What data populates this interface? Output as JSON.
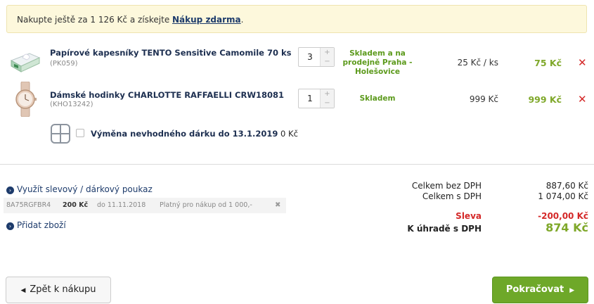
{
  "banner": {
    "text": "Nakupte ještě za 1 126 Kč a získejte ",
    "link": "Nákup zdarma",
    "suffix": "."
  },
  "items": [
    {
      "name": "Papírové kapesníky TENTO Sensitive Camomile 70 ks",
      "code": "(PK059)",
      "qty": "3",
      "stock": "Skladem a na prodejně Praha - Holešovice",
      "unit_price": "25 Kč / ks",
      "total": "75 Kč",
      "remove": "✕",
      "icon": "tissue-box-icon"
    },
    {
      "name": "Dámské hodinky CHARLOTTE RAFFAELLI CRW18081",
      "code": "(KHO13242)",
      "qty": "1",
      "stock": "Skladem",
      "unit_price": "999 Kč",
      "total": "999 Kč",
      "remove": "✕",
      "icon": "wristwatch-icon"
    }
  ],
  "gift_exchange": {
    "label": "Výměna nevhodného dárku do 13.1.2019",
    "price": " 0 Kč",
    "icon": "gift-icon"
  },
  "voucher_link": "Využít slevový / dárkový poukaz",
  "voucher": {
    "code": "8A75RGFBR4",
    "value": "200 Kč",
    "validity": "do 11.11.2018",
    "condition": "Platný pro nákup od 1 000,-",
    "remove": "✖"
  },
  "add_goods_link": "Přidat zboží",
  "summary": {
    "without_vat_label": "Celkem bez DPH",
    "without_vat": "887,60 Kč",
    "with_vat_label": "Celkem s DPH",
    "with_vat": "1 074,00 Kč",
    "discount_label": "Sleva",
    "discount": "-200,00 Kč",
    "to_pay_label": "K úhradě s DPH",
    "to_pay": "874 Kč"
  },
  "buttons": {
    "back": "Zpět k nákupu",
    "continue": "Pokračovat"
  },
  "colors": {
    "accent_green": "#6ea829",
    "price_green": "#7fa82a",
    "remove_red": "#d42828",
    "link_blue": "#1d3b6b"
  }
}
